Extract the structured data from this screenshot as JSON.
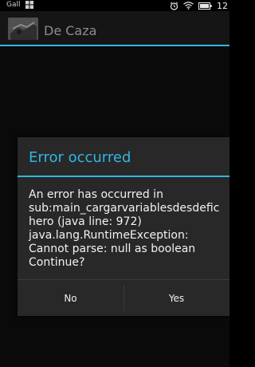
{
  "status_bar": {
    "carrier": "Gall",
    "time": "12",
    "icons": [
      "windows-icon",
      "alarm-icon",
      "wifi-icon",
      "battery-icon"
    ]
  },
  "action_bar": {
    "title": "De Caza",
    "accent_color": "#33b5e5"
  },
  "dialog": {
    "title": "Error occurred",
    "message_lines": [
      "An error has occurred in",
      "sub:main_cargarvariablesdesdefic",
      "hero (java line: 972)",
      "java.lang.RuntimeException:",
      "Cannot parse: null as boolean",
      "Continue?"
    ],
    "buttons": {
      "negative": "No",
      "positive": "Yes"
    }
  }
}
